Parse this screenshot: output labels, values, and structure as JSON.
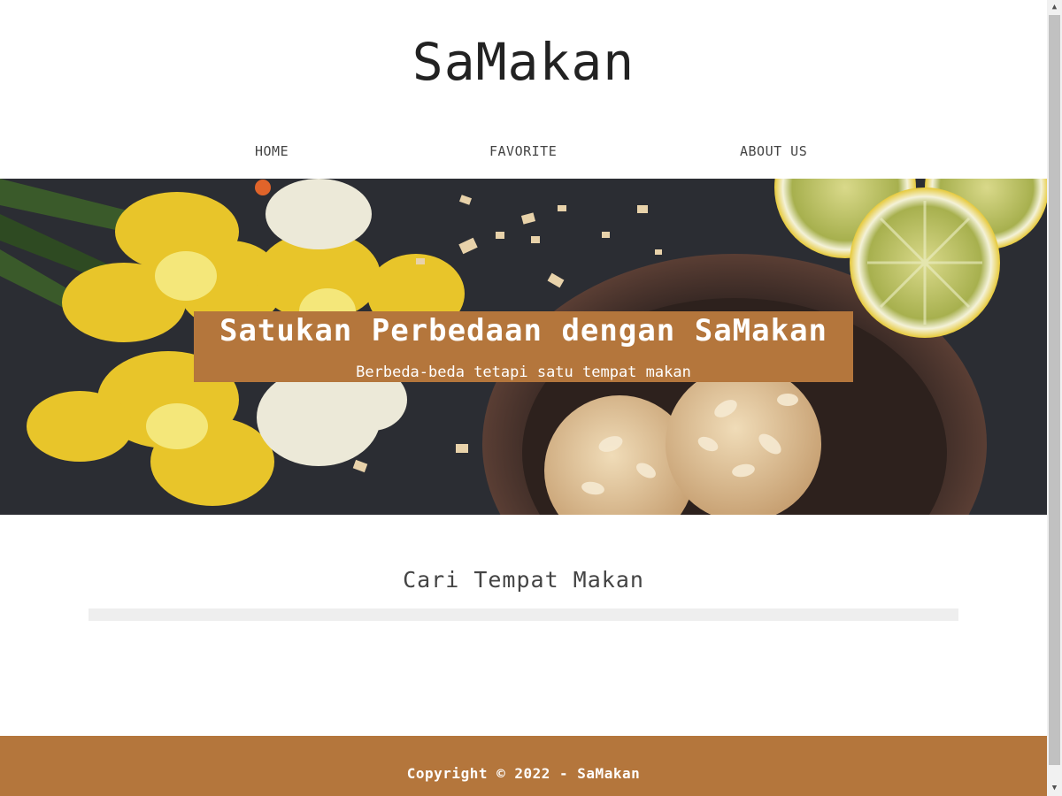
{
  "header": {
    "title": "SaMakan",
    "nav": [
      {
        "label": "HOME"
      },
      {
        "label": "FAVORITE"
      },
      {
        "label": "ABOUT US"
      }
    ]
  },
  "hero": {
    "title": "Satukan Perbedaan dengan SaMakan",
    "subtitle": "Berbeda-beda tetapi satu tempat makan",
    "image": "food-flatlay-cookies-lemons-daffodils"
  },
  "main": {
    "section_title": "Cari Tempat Makan"
  },
  "footer": {
    "copyright": "Copyright © 2022 - SaMakan"
  },
  "colors": {
    "accent": "#b4763c",
    "text_dark": "#222222",
    "list_placeholder": "#eeeeee"
  }
}
